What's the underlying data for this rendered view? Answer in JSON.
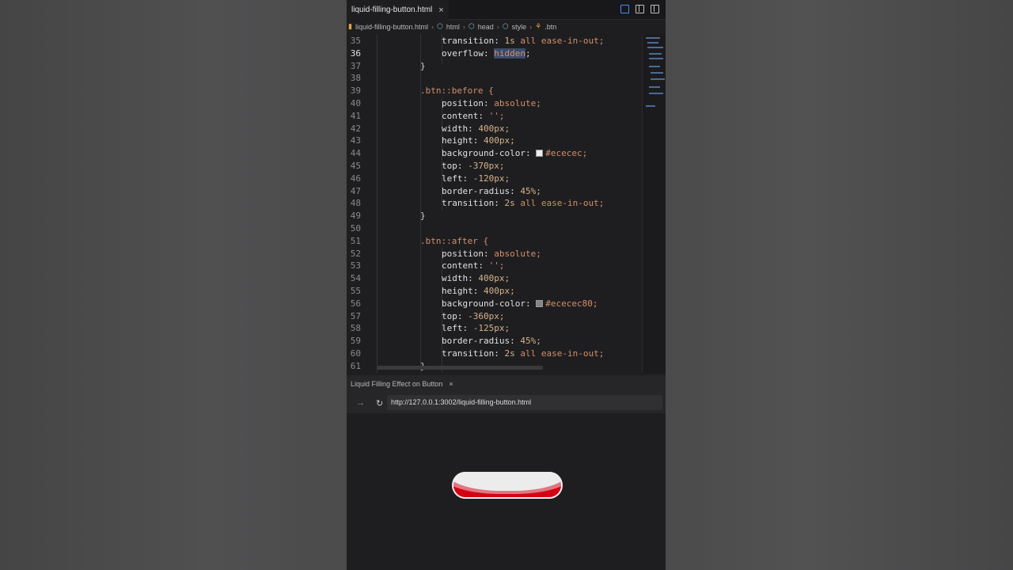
{
  "editor_tab": {
    "filename": "liquid-filling-button.html",
    "close": "×"
  },
  "breadcrumb": {
    "items": [
      "liquid-filling-button.html",
      "html",
      "head",
      "style",
      ".btn"
    ]
  },
  "code_lines": [
    {
      "n": "35",
      "text": "transition: 1s all ease-in-out;"
    },
    {
      "n": "36",
      "text": "overflow: hidden;"
    },
    {
      "n": "37",
      "text": "}"
    },
    {
      "n": "38",
      "text": ""
    },
    {
      "n": "39",
      "text": ".btn::before {"
    },
    {
      "n": "40",
      "text": "position: absolute;"
    },
    {
      "n": "41",
      "text": "content: '';"
    },
    {
      "n": "42",
      "text": "width: 400px;"
    },
    {
      "n": "43",
      "text": "height: 400px;"
    },
    {
      "n": "44",
      "text": "background-color: #ececec;"
    },
    {
      "n": "45",
      "text": "top: -370px;"
    },
    {
      "n": "46",
      "text": "left: -120px;"
    },
    {
      "n": "47",
      "text": "border-radius: 45%;"
    },
    {
      "n": "48",
      "text": "transition: 2s all ease-in-out;"
    },
    {
      "n": "49",
      "text": "}"
    },
    {
      "n": "50",
      "text": ""
    },
    {
      "n": "51",
      "text": ".btn::after {"
    },
    {
      "n": "52",
      "text": "position: absolute;"
    },
    {
      "n": "53",
      "text": "content: '';"
    },
    {
      "n": "54",
      "text": "width: 400px;"
    },
    {
      "n": "55",
      "text": "height: 400px;"
    },
    {
      "n": "56",
      "text": "background-color: #ececec80;"
    },
    {
      "n": "57",
      "text": "top: -360px;"
    },
    {
      "n": "58",
      "text": "left: -125px;"
    },
    {
      "n": "59",
      "text": "border-radius: 45%;"
    },
    {
      "n": "60",
      "text": "transition: 2s all ease-in-out;"
    },
    {
      "n": "61",
      "text": "}"
    }
  ],
  "active_line": "36",
  "colors": {
    "swatch_before": "#ececec",
    "swatch_after": "#ececec80",
    "button_red": "#d40014",
    "selection": "#3a4a6a"
  },
  "browser": {
    "tab_title": "Liquid Filling Effect on Button",
    "close": "×",
    "back_icon": "arrow-right-icon",
    "reload_icon": "reload-icon",
    "url": "http://127.0.0.1:3002/liquid-filling-button.html"
  }
}
